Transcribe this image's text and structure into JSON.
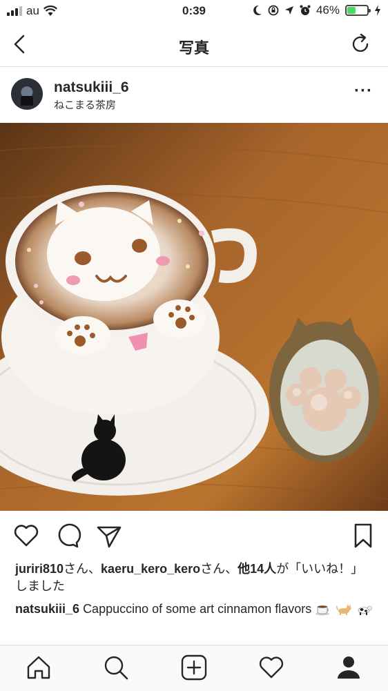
{
  "status_bar": {
    "carrier": "au",
    "time": "0:39",
    "battery_percent": "46%",
    "battery_level": 0.46,
    "icons": [
      "signal-icon",
      "wifi-icon",
      "moon-icon",
      "rotation-lock-icon",
      "location-icon",
      "alarm-icon",
      "battery-icon",
      "charging-icon"
    ]
  },
  "nav": {
    "title": "写真",
    "back_icon": "chevron-left-icon",
    "refresh_icon": "refresh-icon"
  },
  "post": {
    "username": "natsukiii_6",
    "location": "ねこまる茶房",
    "more_icon": "more-icon",
    "photo_icon": "post-photo"
  },
  "actions": {
    "icons": [
      "heart-icon",
      "comment-icon",
      "share-icon",
      "bookmark-icon"
    ]
  },
  "likes": {
    "user1": "juriri810",
    "sep1": "さん、",
    "user2": "kaeru_kero_kero",
    "sep2": "さん、",
    "others": "他14人",
    "suffix": "が「いいね！」しました"
  },
  "caption": {
    "username": "natsukiii_6",
    "text": "Cappuccino of some art cinnamon flavors",
    "emojis": [
      "coffee-emoji",
      "cat-emoji",
      "cow-emoji"
    ]
  },
  "colors": {
    "accent_text": "#262626",
    "border": "#dbdbdb",
    "battery_green": "#4cd964"
  },
  "tab_bar": {
    "icons": [
      "home-icon",
      "search-icon",
      "add-icon",
      "heart-icon",
      "profile-icon"
    ]
  }
}
